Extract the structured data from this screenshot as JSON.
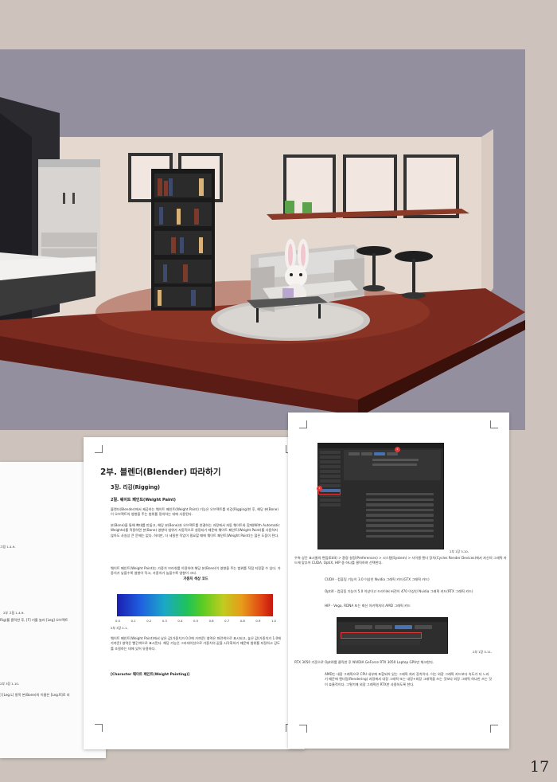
{
  "page_number": "17",
  "render": {
    "colors": {
      "wall": "#e7dbd3",
      "floor": "#7a2a1e",
      "sky": "#948f9f",
      "dark": "#2b2a2e"
    }
  },
  "left_page": {
    "cap1": "그림 1-4-9-",
    "cap2": "2부 그림 1-4-9-",
    "p1": "Rig)를 클릭한 후, [F] 키를 눌러 [Leg] 오브젝트",
    "cap3": "2부 3장 1-10-",
    "p2": "] [Leg.L] 항목 본(Bone)의 이름은 [Leg.R]로 지"
  },
  "mid_page": {
    "part_title": "2부. 블렌더(Blender) 따라하기",
    "chapter": "3장. 리깅(Rigging)",
    "section": "2절. 웨이트 페인트(Weight Paint)",
    "p1": "블렌더(Blender)에서 제공하는 웨이트 페인트(Weight Paint) 기능은 오브젝트를 리깅(Rigging)한 후, 해당 본(Bone)이 오브젝트의 영향을 주는 범위를 정의하는 데에 사용된다.",
    "p2": "본(Bone)을 통해 뼈대를 만들고, 해당 본(Bone)과 오브젝트를 연결하는 과정에서 자동 웨이트와 함께(With Automatic Weights)를 적용하면 본(Bone) 영향의 범위가 자동적으로 설정되기 때문에 웨이트 페인트(Weight Paint)를 사용하지 않아도 사실상 큰 문제는 없다. 하지만, 더 세밀한 작업이 필요할 때에 웨이트 페인트(Weight Paint)는 많은 도움이 된다.",
    "empty": "",
    "p3": "웨이트 페인트(Weight Paint)는 가중치 브러쉬를 이용하여 해당 본(Bone)이 영향을 주는 범위를 직접 지정할 수 있다. 가중치가 낮을수록 영향이 작고, 가중치가 높을수록 영향이 크다.",
    "fig_title": "가중치 색상 코드",
    "ticks": [
      "0.0",
      "0.1",
      "0.2",
      "0.3",
      "0.4",
      "0.5",
      "0.6",
      "0.7",
      "0.8",
      "0.9",
      "1.0"
    ],
    "fig_caption": "2부 3장 2-1-",
    "p4": "웨이트 페인트(Weight Paint)에서 낮은 값(가중치가 0.0에 가까운) 영역은 파란색으로 표시되고, 높은 값(가중치가 1.0에 가까운) 영역은 빨간색으로 표시된다. 해당 가능은 그라데이션으로 가중치의 값을 시각화하기 때문에 범위를 지정하고 강도를 조절하는 데에 있어 유용하다.",
    "empty2": "",
    "subsection": "[Character 웨이트 페인트(Weight Painting)]"
  },
  "right_page": {
    "fig1_caption": "2부 1장 3-10-",
    "p1": "우측 상단 표시줄의 편집(Edit) > 환경 설정(Preferences) > 시스템(System) > 사이클 렌더 장치(Cycles Render Devices)에서 자신의 그래픽 카드에 맞추어 CUDA, OptiX, HIP 중 하나를 클릭하여 선택한다.",
    "b1": "CUDA - 컴퓨팅 기능이 3.0 이상인 Nvidia 그래픽 카드(GTX 그래픽 카드)",
    "b2": "OptiX - 컴퓨팅 기능이 5.0 이상이고 드라이버 버전이 470 이상인 Nvidia 그래픽 카드(RTX 그래픽 카드)",
    "b3": "HIP - Vega, RDNA 또는 최신 아키텍처의 AMD 그래픽 카드",
    "fig2_caption": "2부 1장 3-11-",
    "p2": "RTX 3050 기준으로 OptiX를 클릭한 후 NVIDIA GeForce RTX 3050 Laptop GPU만 체크한다.",
    "b4": "AMD는 내장 그래픽으로 CPU 내부에 포함되어 있는 그래픽 처리 장치이다. 이는 외장 그래픽 카드보다 속도가 더 느리기 때문에 렌더링(Rendering) 과정에서 내장 그래픽 또는 내장+외장 그래픽을 쓰는 것보다 외장 그래픽 하나만 쓰는 것이 효율적이다. 그렇기에 외장 그래픽인 RTX만 사용하도록 한다.",
    "shot1_badge_a": "2",
    "shot1_badge_b": "1",
    "cycles_tabs": [
      "None",
      "CUDA",
      "OptiX",
      "HIP"
    ],
    "gpu_option": "NVIDIA GeForce RTX 3050 Laptop GPU",
    "cpu_option": "AMD Ryzen 7 5800H with Radeon Graphics"
  }
}
